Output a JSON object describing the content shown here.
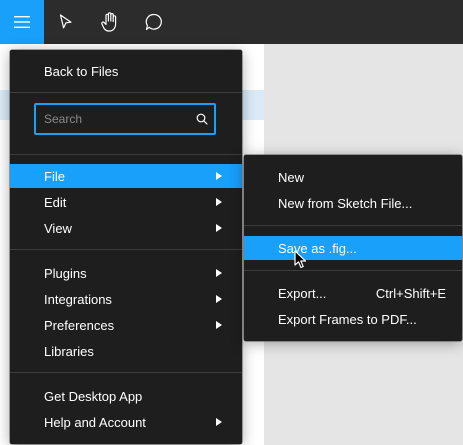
{
  "toolbar": {
    "tools": [
      {
        "icon": "hamburger-menu-icon",
        "active": true
      },
      {
        "icon": "move-cursor-icon",
        "active": false
      },
      {
        "icon": "hand-icon",
        "active": false
      },
      {
        "icon": "comment-icon",
        "active": false
      }
    ],
    "accent": "#18a0fb"
  },
  "main_menu": {
    "back_to_files": "Back to Files",
    "search": {
      "placeholder": "Search",
      "value": ""
    },
    "file": "File",
    "edit": "Edit",
    "view": "View",
    "plugins": "Plugins",
    "integrations": "Integrations",
    "preferences": "Preferences",
    "libraries": "Libraries",
    "get_desktop_app": "Get Desktop App",
    "help_and_account": "Help and Account"
  },
  "file_submenu": {
    "new": "New",
    "new_from_sketch": "New from Sketch File...",
    "save_as_fig": "Save as .fig...",
    "export": "Export...",
    "export_shortcut": "Ctrl+Shift+E",
    "export_frames_pdf": "Export Frames to PDF..."
  }
}
